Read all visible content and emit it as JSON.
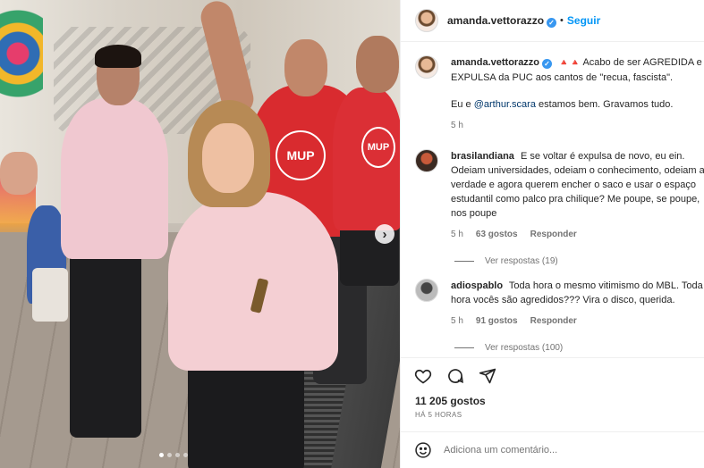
{
  "post": {
    "author": "amanda.vettorazzo",
    "follow_label": "Seguir",
    "separator": "•",
    "caption_text_1": "Acabo de ser AGREDIDA e EXPULSA da PUC aos cantos de \"recua, fascista\".",
    "caption_text_2_pre": "Eu e",
    "caption_mention": "@arthur.scara",
    "caption_text_2_post": "estamos bem. Gravamos tudo.",
    "caption_time": "5 h",
    "shirt_logo": "MUP",
    "likes": "11 205 gostos",
    "posted_ago": "HÁ 5 HORAS",
    "comment_placeholder": "Adiciona um comentário..."
  },
  "comments": [
    {
      "user": "brasilandiana",
      "text": "E se voltar é expulsa de novo, eu ein. Odeiam universidades, odeiam o conhecimento, odeiam a verdade e agora querem encher o saco e usar o espaço estudantil como palco pra chilique? Me poupe, se poupe, nos poupe",
      "time": "5 h",
      "likes": "63 gostos",
      "reply_label": "Responder",
      "view_replies": "Ver respostas (19)"
    },
    {
      "user": "adiospablo",
      "text": "Toda hora o mesmo vitimismo do MBL. Toda hora vocês são agredidos??? Vira o disco, querida.",
      "time": "5 h",
      "likes": "91 gostos",
      "reply_label": "Responder",
      "view_replies": "Ver respostas (100)"
    }
  ],
  "icons": [
    "heart-icon",
    "comment-icon",
    "share-icon",
    "emoji-icon",
    "verified-icon",
    "chevron-right-icon",
    "fire-icon"
  ],
  "colors": {
    "accent": "#0095f6",
    "verified": "#3897f0",
    "muted": "#737373",
    "mention": "#00376b"
  },
  "carousel": {
    "total": 4,
    "active": 1
  }
}
